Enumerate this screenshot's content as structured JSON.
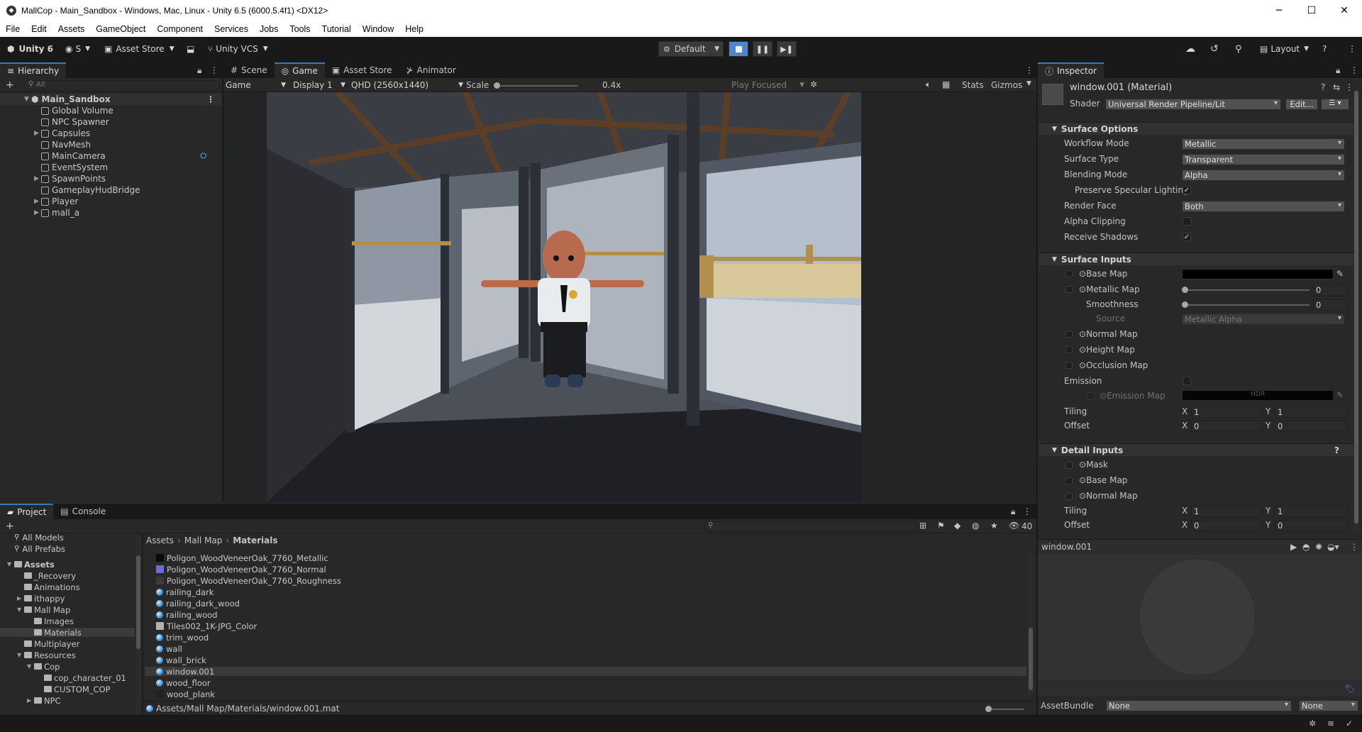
{
  "window": {
    "title": "MallCop - Main_Sandbox - Windows, Mac, Linux - Unity 6.5 (6000.5.4f1) <DX12>",
    "minimize": "─",
    "maximize": "☐",
    "close": "✕"
  },
  "menu": [
    "File",
    "Edit",
    "Assets",
    "GameObject",
    "Component",
    "Services",
    "Jobs",
    "Tools",
    "Tutorial",
    "Window",
    "Help"
  ],
  "toolbar": {
    "unity_label": "Unity 6",
    "account": "S",
    "asset_store": "Asset Store",
    "vcs": "Unity VCS",
    "default_label": "Default",
    "layout": "Layout"
  },
  "hierarchy": {
    "tab": "Hierarchy",
    "search_placeholder": "All",
    "scene": "Main_Sandbox",
    "items": [
      {
        "label": "Global Volume",
        "expandable": false
      },
      {
        "label": "NPC Spawner",
        "expandable": false
      },
      {
        "label": "Capsules",
        "expandable": true
      },
      {
        "label": "NavMesh",
        "expandable": false
      },
      {
        "label": "MainCamera",
        "expandable": false
      },
      {
        "label": "EventSystem",
        "expandable": false
      },
      {
        "label": "SpawnPoints",
        "expandable": true
      },
      {
        "label": "GameplayHudBridge",
        "expandable": false
      },
      {
        "label": "Player",
        "expandable": true
      },
      {
        "label": "mall_a",
        "expandable": true
      }
    ]
  },
  "center_tabs": [
    "Scene",
    "Game",
    "Asset Store",
    "Animator"
  ],
  "game_bar": {
    "view": "Game",
    "display": "Display 1",
    "resolution": "QHD (2560x1440)",
    "scale_label": "Scale",
    "scale_value": "0.4x",
    "play_mode": "Play Focused",
    "stats": "Stats",
    "gizmos": "Gizmos"
  },
  "inspector": {
    "tab": "Inspector",
    "material_name": "window.001 (Material)",
    "shader_label": "Shader",
    "shader_value": "Universal Render Pipeline/Lit",
    "edit_button": "Edit...",
    "surface_options": {
      "title": "Surface Options",
      "rows": [
        {
          "label": "Workflow Mode",
          "value": "Metallic"
        },
        {
          "label": "Surface Type",
          "value": "Transparent"
        },
        {
          "label": "Blending Mode",
          "value": "Alpha"
        }
      ],
      "preserve_specular": "Preserve Specular Lighting",
      "render_face_label": "Render Face",
      "render_face_value": "Both",
      "alpha_clipping": "Alpha Clipping",
      "receive_shadows": "Receive Shadows"
    },
    "surface_inputs": {
      "title": "Surface Inputs",
      "base_map": "Base Map",
      "metallic_map": "Metallic Map",
      "metallic_value": "0",
      "smoothness": "Smoothness",
      "smoothness_value": "0",
      "source_label": "Source",
      "source_value": "Metallic Alpha",
      "normal_map": "Normal Map",
      "height_map": "Height Map",
      "occlusion_map": "Occlusion Map",
      "emission": "Emission",
      "emission_map": "Emission Map",
      "hdr": "HDR",
      "tiling": "Tiling",
      "offset": "Offset",
      "x": "X",
      "y": "Y",
      "tiling_x": "1",
      "tiling_y": "1",
      "offset_x": "0",
      "offset_y": "0"
    },
    "detail_inputs": {
      "title": "Detail Inputs",
      "mask": "Mask",
      "base_map": "Base Map",
      "normal_map": "Normal Map",
      "tiling": "Tiling",
      "offset": "Offset",
      "tiling_x": "1",
      "tiling_y": "1",
      "offset_x": "0",
      "offset_y": "0"
    },
    "preview_title": "window.001",
    "assetbundle_label": "AssetBundle",
    "assetbundle_value": "None",
    "assetbundle_variant": "None"
  },
  "project": {
    "tabs": [
      "Project",
      "Console"
    ],
    "visible_count": "40",
    "breadcrumb": [
      "Assets",
      "Mall Map",
      "Materials"
    ],
    "tree": [
      {
        "label": "All Models",
        "indent": 0,
        "type": "search"
      },
      {
        "label": "All Prefabs",
        "indent": 0,
        "type": "search"
      },
      {
        "label": "Assets",
        "indent": 0,
        "type": "folder",
        "bold": true
      },
      {
        "label": "_Recovery",
        "indent": 1,
        "type": "folder"
      },
      {
        "label": "Animations",
        "indent": 1,
        "type": "folder"
      },
      {
        "label": "ithappy",
        "indent": 1,
        "type": "folder"
      },
      {
        "label": "Mall Map",
        "indent": 1,
        "type": "folder"
      },
      {
        "label": "Images",
        "indent": 2,
        "type": "folder"
      },
      {
        "label": "Materials",
        "indent": 2,
        "type": "folder",
        "selected": true
      },
      {
        "label": "Multiplayer",
        "indent": 1,
        "type": "folder"
      },
      {
        "label": "Resources",
        "indent": 1,
        "type": "folder"
      },
      {
        "label": "Cop",
        "indent": 2,
        "type": "folder"
      },
      {
        "label": "cop_character_01",
        "indent": 3,
        "type": "folder"
      },
      {
        "label": "CUSTOM_COP",
        "indent": 3,
        "type": "folder"
      },
      {
        "label": "NPC",
        "indent": 2,
        "type": "folder"
      }
    ],
    "files": [
      {
        "label": "Poligon_WoodVeneerOak_7760_Metallic",
        "icon": "tex-black"
      },
      {
        "label": "Poligon_WoodVeneerOak_7760_Normal",
        "icon": "tex-normal"
      },
      {
        "label": "Poligon_WoodVeneerOak_7760_Roughness",
        "icon": "tex-dark"
      },
      {
        "label": "railing_dark",
        "icon": "material"
      },
      {
        "label": "railing_dark_wood",
        "icon": "material"
      },
      {
        "label": "railing_wood",
        "icon": "material"
      },
      {
        "label": "Tiles002_1K-JPG_Color",
        "icon": "tex-grey"
      },
      {
        "label": "trim_wood",
        "icon": "material"
      },
      {
        "label": "wall",
        "icon": "material"
      },
      {
        "label": "wall_brick",
        "icon": "material"
      },
      {
        "label": "window.001",
        "icon": "material",
        "selected": true
      },
      {
        "label": "wood_floor",
        "icon": "material"
      },
      {
        "label": "wood_plank",
        "icon": "tex-brown"
      }
    ],
    "status_path": "Assets/Mall Map/Materials/window.001.mat"
  },
  "colors": {
    "accent": "#3a79bb",
    "panel": "#282828",
    "background": "#191919"
  }
}
